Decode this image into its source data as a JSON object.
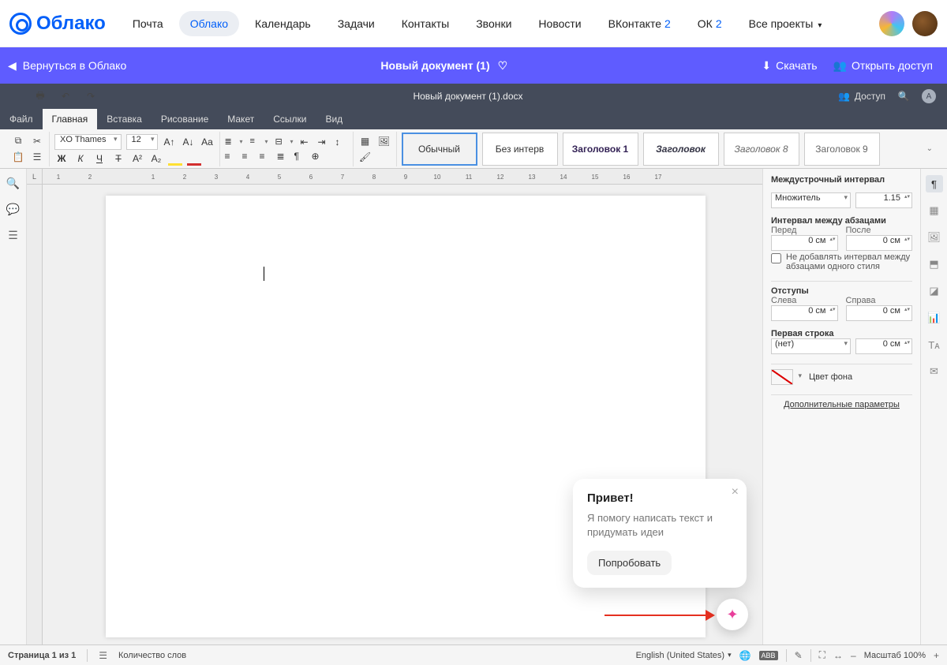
{
  "topbar": {
    "brand": "Облако",
    "items": [
      {
        "label": "Почта"
      },
      {
        "label": "Облако",
        "active": true
      },
      {
        "label": "Календарь"
      },
      {
        "label": "Задачи"
      },
      {
        "label": "Контакты"
      },
      {
        "label": "Звонки"
      },
      {
        "label": "Новости"
      },
      {
        "label": "ВКонтакте",
        "count": "2"
      },
      {
        "label": "ОК",
        "count": "2"
      },
      {
        "label": "Все проекты",
        "dropdown": true
      }
    ]
  },
  "purple": {
    "back": "Вернуться в Облако",
    "title": "Новый документ (1)",
    "download": "Скачать",
    "share": "Открыть доступ"
  },
  "graybar": {
    "filename": "Новый документ (1).docx",
    "access": "Доступ",
    "avatar_letter": "A"
  },
  "tabs": [
    "Файл",
    "Главная",
    "Вставка",
    "Рисование",
    "Макет",
    "Ссылки",
    "Вид"
  ],
  "active_tab": 1,
  "toolbar": {
    "font": "XO Thames",
    "size": "12",
    "styles": [
      "Обычный",
      "Без интерв",
      "Заголовок 1",
      "Заголовок",
      "Заголовок 8",
      "Заголовок 9"
    ]
  },
  "prop": {
    "line_spacing_title": "Междустрочный интервал",
    "multiplier_label": "Множитель",
    "multiplier_value": "1.15",
    "para_spacing_title": "Интервал между абзацами",
    "before_label": "Перед",
    "after_label": "После",
    "before_value": "0 см",
    "after_value": "0 см",
    "no_add_label": "Не добавлять интервал между абзацами одного стиля",
    "indents_title": "Отступы",
    "left_label": "Слева",
    "right_label": "Справа",
    "left_value": "0 см",
    "right_value": "0 см",
    "firstline_title": "Первая строка",
    "firstline_sel": "(нет)",
    "firstline_value": "0 см",
    "bg_label": "Цвет фона",
    "more": "Дополнительные параметры"
  },
  "ai": {
    "title": "Привет!",
    "text": "Я помогу написать текст и придумать идеи",
    "button": "Попробовать"
  },
  "statusbar": {
    "page": "Страница 1 из 1",
    "wc": "Количество слов",
    "lang": "English (United States)",
    "zoom": "Масштаб 100%"
  },
  "ruler_marks": [
    "1",
    "2",
    "",
    "1",
    "2",
    "3",
    "4",
    "5",
    "6",
    "7",
    "8",
    "9",
    "10",
    "11",
    "12",
    "13",
    "14",
    "15",
    "16",
    "17"
  ]
}
